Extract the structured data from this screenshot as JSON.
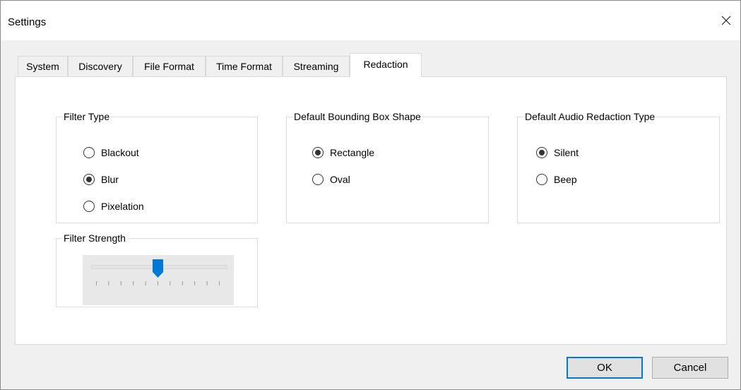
{
  "window": {
    "title": "Settings"
  },
  "tabs": [
    {
      "label": "System",
      "active": false
    },
    {
      "label": "Discovery",
      "active": false
    },
    {
      "label": "File Format",
      "active": false
    },
    {
      "label": "Time Format",
      "active": false
    },
    {
      "label": "Streaming",
      "active": false
    },
    {
      "label": "Redaction",
      "active": true
    }
  ],
  "filter_type": {
    "legend": "Filter Type",
    "options": [
      {
        "label": "Blackout",
        "selected": false
      },
      {
        "label": "Blur",
        "selected": true
      },
      {
        "label": "Pixelation",
        "selected": false
      }
    ]
  },
  "bounding_box": {
    "legend": "Default Bounding Box Shape",
    "options": [
      {
        "label": "Rectangle",
        "selected": true
      },
      {
        "label": "Oval",
        "selected": false
      }
    ]
  },
  "audio": {
    "legend": "Default Audio Redaction Type",
    "options": [
      {
        "label": "Silent",
        "selected": true
      },
      {
        "label": "Beep",
        "selected": false
      }
    ]
  },
  "filter_strength": {
    "legend": "Filter Strength",
    "value_fraction": 0.5,
    "tick_count": 11
  },
  "buttons": {
    "ok": "OK",
    "cancel": "Cancel"
  },
  "colors": {
    "accent": "#0078d7",
    "panel": "#ffffff",
    "window": "#f0f0f0"
  }
}
